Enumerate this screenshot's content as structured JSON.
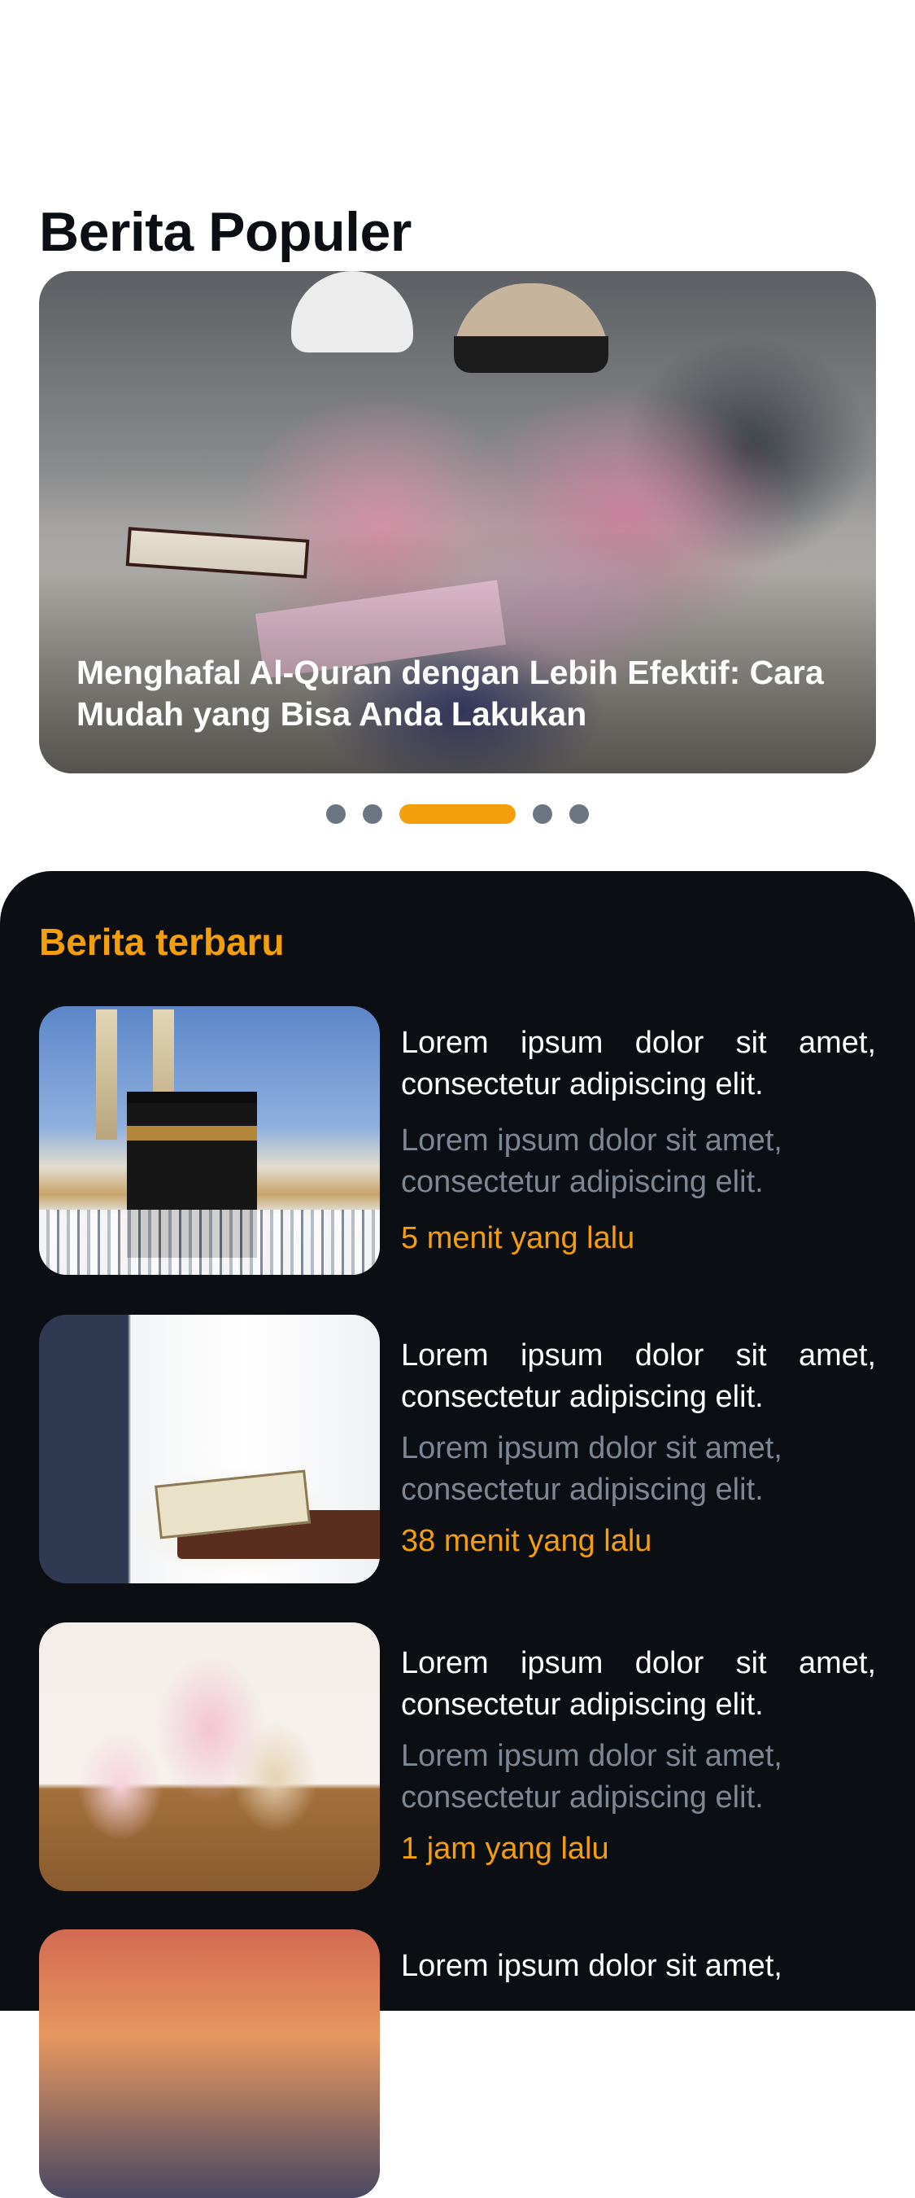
{
  "popular": {
    "title": "Berita Populer",
    "featured": {
      "caption": "Menghafal Al-Quran dengan Lebih Efektif: Cara Mudah yang Bisa Anda Lakukan",
      "image": "boys-reading-quran-photo"
    },
    "carousel": {
      "total": 5,
      "active_index": 2
    }
  },
  "latest": {
    "title": "Berita terbaru",
    "items": [
      {
        "image": "kaaba-mecca-photo",
        "title": "Lorem ipsum dolor sit amet, consectetur adipiscing elit.",
        "excerpt": "Lorem ipsum dolor sit amet, consectetur adipiscing elit.",
        "time": "5 menit yang lalu"
      },
      {
        "image": "man-reading-quran-photo",
        "title": "Lorem ipsum dolor sit amet, consectetur adipiscing elit.",
        "excerpt": "Lorem ipsum dolor sit amet, consectetur adipiscing elit.",
        "time": "38 menit yang lalu"
      },
      {
        "image": "mother-daughters-hijab-photo",
        "title": "Lorem ipsum dolor sit amet, consectetur adipiscing elit.",
        "excerpt": "Lorem ipsum dolor sit amet, consectetur adipiscing elit.",
        "time": "1 jam yang lalu"
      },
      {
        "image": "sunset-sky-photo",
        "title": "Lorem ipsum dolor sit amet,"
      }
    ]
  },
  "colors": {
    "accent": "#f59e0b",
    "sheet_background": "#0b0f14",
    "muted_text": "#7d8794",
    "inactive_dot": "#6c7683"
  }
}
